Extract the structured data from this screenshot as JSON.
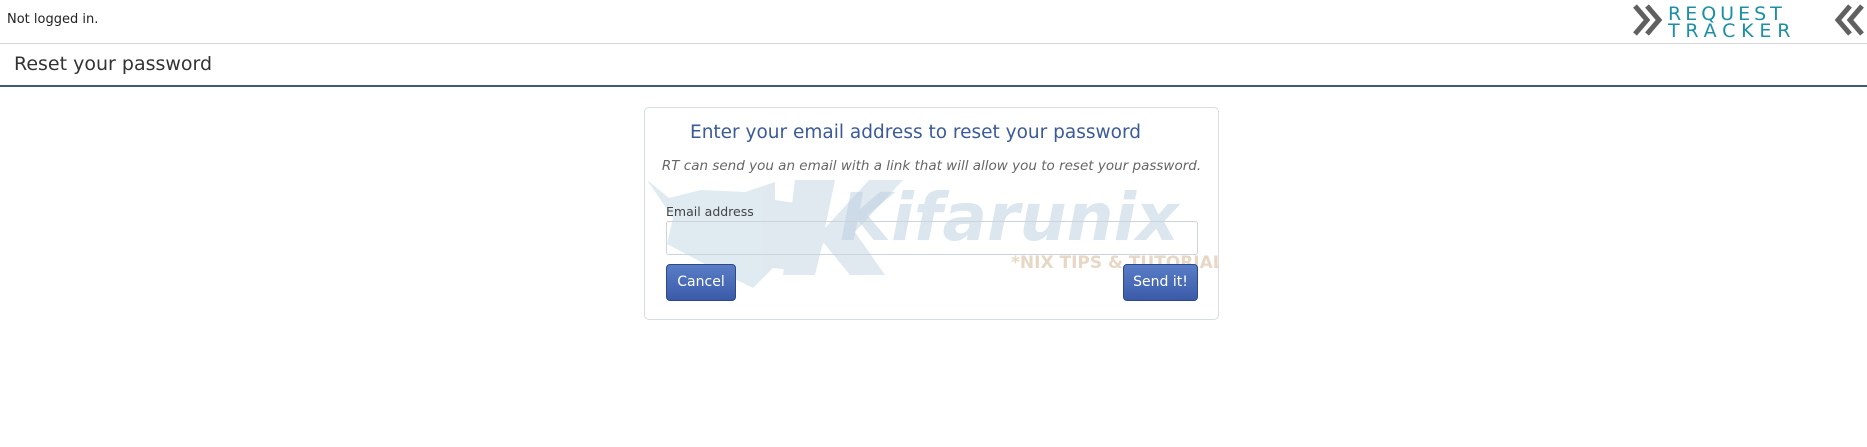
{
  "header": {
    "login_status": "Not logged in.",
    "logo": {
      "line1": "REQUEST",
      "line2": "TRACKER",
      "icon": "double-chevron-icon",
      "color_chevron": "#606060",
      "color_text": "#1d8fa5"
    }
  },
  "page": {
    "title": "Reset your password"
  },
  "form": {
    "heading": "Enter your email address to reset your password",
    "hint": "RT can send you an email with a link that will allow you to reset your password.",
    "email_label": "Email address",
    "email_value": "",
    "cancel_label": "Cancel",
    "submit_label": "Send it!"
  },
  "watermark": {
    "brand": "Kifarunix",
    "tagline": "*NIX TIPS & TUTORIALS"
  },
  "colors": {
    "accent": "#3a5a99",
    "button": "#3b5ba8",
    "title_rule": "#415a7a"
  }
}
